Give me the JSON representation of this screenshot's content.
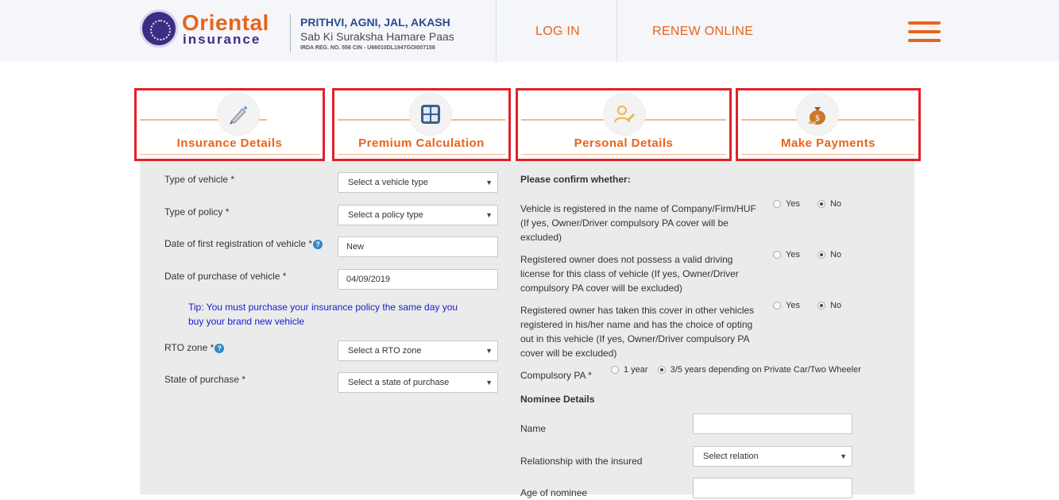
{
  "header": {
    "brand_line1": "Oriental",
    "brand_line2": "insurance",
    "tagline1": "PRITHVI, AGNI, JAL, AKASH",
    "tagline2": "Sab Ki Suraksha Hamare Paas",
    "reg_info": "IRDA REG. NO. 556   CIN - U66010DL1947GOI007158",
    "login": "LOG IN",
    "renew": "RENEW ONLINE",
    "accent_color": "#e8641b"
  },
  "steps": [
    {
      "label": "Insurance Details",
      "icon": "pen-icon"
    },
    {
      "label": "Premium Calculation",
      "icon": "calculator-icon"
    },
    {
      "label": "Personal Details",
      "icon": "user-edit-icon"
    },
    {
      "label": "Make Payments",
      "icon": "money-bag-icon"
    }
  ],
  "left_form": {
    "vehicle_type_label": "Type of vehicle *",
    "vehicle_type_value": "Select a vehicle type",
    "policy_type_label": "Type of policy *",
    "policy_type_value": "Select a policy type",
    "first_reg_label": "Date of first registration of vehicle *",
    "first_reg_value": "New",
    "purchase_date_label": "Date of purchase of vehicle *",
    "purchase_date_value": "04/09/2019",
    "tip": "Tip: You must purchase your insurance policy the same day you buy your brand new vehicle",
    "rto_label": "RTO zone *",
    "rto_value": "Select a RTO zone",
    "state_label": "State of purchase *",
    "state_value": "Select a state of purchase"
  },
  "right_form": {
    "confirm_heading": "Please confirm whether:",
    "q1": "Vehicle is registered in the name of Company/Firm/HUF (If yes, Owner/Driver compulsory PA cover will be excluded)",
    "q2": "Registered owner does not possess a valid driving license for this class of vehicle (If yes, Owner/Driver compulsory PA cover will be excluded)",
    "q3": "Registered owner has taken this cover in other vehicles registered in his/her name and has the choice of opting out in this vehicle (If yes, Owner/Driver compulsory PA cover will be excluded)",
    "yes": "Yes",
    "no": "No",
    "compulsory_pa_label": "Compulsory PA *",
    "pa_option1": "1 year",
    "pa_option2": "3/5 years depending on Private Car/Two Wheeler",
    "nominee_heading": "Nominee Details",
    "name_label": "Name",
    "name_value": "",
    "relationship_label": "Relationship with the insured",
    "relationship_value": "Select relation",
    "age_label": "Age of nominee",
    "age_value": ""
  }
}
